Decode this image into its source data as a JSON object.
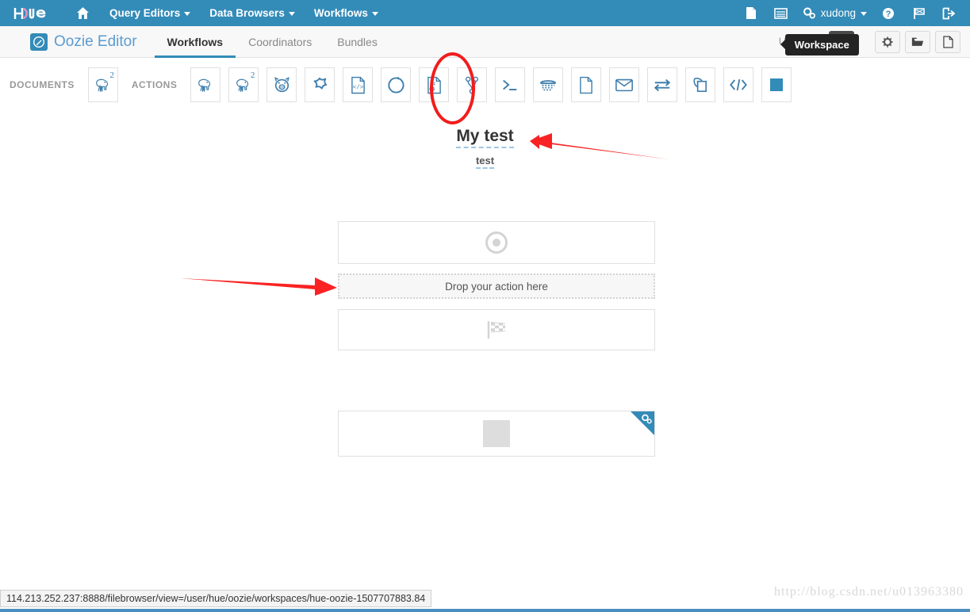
{
  "navbar": {
    "logo_text": "hue",
    "home_icon": "home-icon",
    "items": [
      {
        "label": "Query Editors",
        "icon": "chevron-down-icon"
      },
      {
        "label": "Data Browsers",
        "icon": "chevron-down-icon"
      },
      {
        "label": "Workflows",
        "icon": "chevron-down-icon"
      }
    ],
    "right_icons": [
      "document-icon",
      "list-icon"
    ],
    "user": {
      "label": "xudong",
      "icon": "gears-icon",
      "caret": "chevron-down-icon"
    },
    "trailing_icons": [
      "help-circle-icon",
      "flag-icon",
      "logout-icon"
    ],
    "background": "#338bb8"
  },
  "subheader": {
    "app_badge_icon": "pencil-circle-icon",
    "app_title": "Oozie Editor",
    "tabs": [
      {
        "label": "Workflows",
        "active": true
      },
      {
        "label": "Coordinators",
        "active": false
      },
      {
        "label": "Bundles",
        "active": false
      }
    ],
    "status_label": "Unsaved",
    "edit_button_icon": "pencil-icon",
    "settings_button_icon": "gear-icon",
    "open_button_icon": "folder-open-icon",
    "workspace_button_icon": "document-icon",
    "tooltip": "Workspace"
  },
  "toolbar": {
    "documents_label": "DOCUMENTS",
    "actions_label": "ACTIONS",
    "document_items": [
      {
        "name": "hive2-document-action",
        "icon": "elephant-icon",
        "superscript": "2"
      }
    ],
    "action_items": [
      {
        "name": "hive-action",
        "icon": "elephant-icon",
        "superscript": ""
      },
      {
        "name": "hive2-action",
        "icon": "elephant-icon",
        "superscript": "2"
      },
      {
        "name": "pig-action",
        "icon": "pig-icon",
        "superscript": ""
      },
      {
        "name": "spark-action",
        "icon": "spark-star-icon",
        "superscript": ""
      },
      {
        "name": "java-action",
        "icon": "code-document-icon",
        "superscript": ""
      },
      {
        "name": "sqoop-action",
        "icon": "circle-arrow-icon",
        "superscript": ""
      },
      {
        "name": "shell-action",
        "icon": "script-document-icon",
        "superscript": ""
      },
      {
        "name": "fork-action",
        "icon": "fork-icon",
        "superscript": ""
      },
      {
        "name": "ssh-action",
        "icon": "terminal-icon",
        "superscript": ""
      },
      {
        "name": "sub-workflow-action",
        "icon": "sqoop-icon",
        "superscript": ""
      },
      {
        "name": "fs-action",
        "icon": "file-icon",
        "superscript": ""
      },
      {
        "name": "email-action",
        "icon": "envelope-icon",
        "superscript": ""
      },
      {
        "name": "distcp-action",
        "icon": "exchange-icon",
        "superscript": ""
      },
      {
        "name": "streaming-action",
        "icon": "copy-icon",
        "superscript": ""
      },
      {
        "name": "generic-action",
        "icon": "code-brackets-icon",
        "superscript": ""
      },
      {
        "name": "kill-action",
        "icon": "square-icon",
        "superscript": ""
      }
    ]
  },
  "workflow": {
    "title": "My test",
    "subtitle": "test",
    "nodes": {
      "start": {
        "name": "start-node",
        "icon": "target-dot-icon"
      },
      "drop_zone": {
        "label": "Drop your action here"
      },
      "end": {
        "name": "end-node",
        "icon": "checkered-flag-icon"
      },
      "action": {
        "name": "action-node",
        "icon": "gray-square-icon",
        "corner_icon": "gears-icon"
      }
    }
  },
  "statusbar": {
    "url": "114.213.252.237:8888/filebrowser/view=/user/hue/oozie/workspaces/hue-oozie-1507707883.84"
  },
  "watermark": "http://blog.csdn.net/u013963380",
  "colors": {
    "brand_blue": "#338bb8",
    "icon_blue": "#3f7fad",
    "annotation_red": "#f31b1b",
    "tooltip_dark": "#232323"
  }
}
